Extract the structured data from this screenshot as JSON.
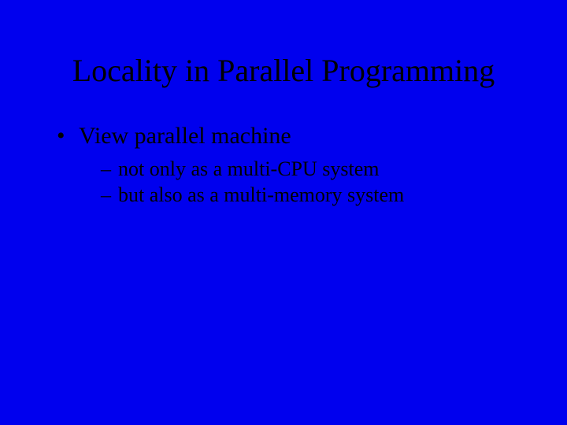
{
  "slide": {
    "title": "Locality in Parallel Programming",
    "bullets": [
      {
        "text": "View parallel machine",
        "sub": [
          "not only as a multi-CPU system",
          "but also as a multi-memory system"
        ]
      }
    ]
  }
}
